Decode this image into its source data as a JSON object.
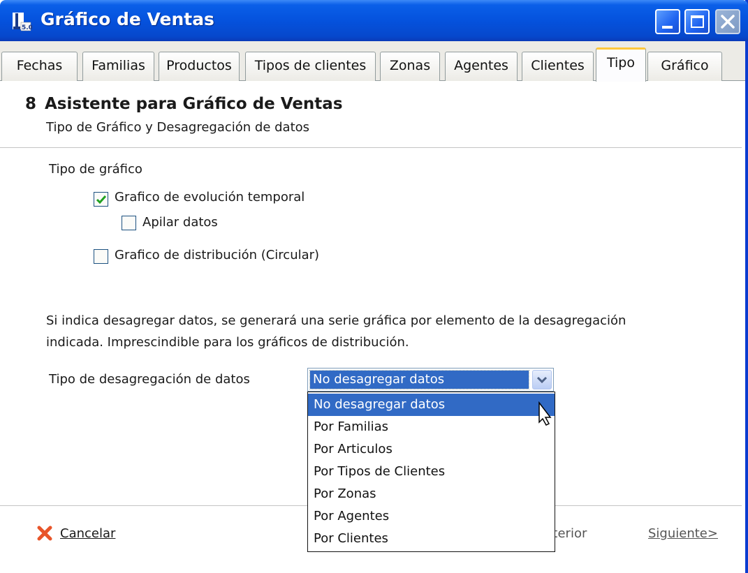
{
  "window": {
    "title": "Gráfico de Ventas"
  },
  "tabs": [
    {
      "label": "Fechas"
    },
    {
      "label": "Familias"
    },
    {
      "label": "Productos"
    },
    {
      "label": "Tipos de clientes"
    },
    {
      "label": "Zonas"
    },
    {
      "label": "Agentes"
    },
    {
      "label": "Clientes"
    },
    {
      "label": "Tipo",
      "active": true
    },
    {
      "label": "Gráfico"
    }
  ],
  "wizard": {
    "step": "8",
    "title": "Asistente para Gráfico de Ventas",
    "subtitle": "Tipo de Gráfico y Desagregación de datos"
  },
  "chart_type": {
    "label": "Tipo de gráfico",
    "options": [
      {
        "label": "Grafico de evolución temporal",
        "checked": true
      },
      {
        "label": "Apilar datos",
        "checked": false
      },
      {
        "label": "Grafico de distribución (Circular)",
        "checked": false
      }
    ]
  },
  "info_text": "Si indica desagregar datos, se generará una serie gráfica por elemento de la desagregación indicada. Imprescindible para los gráficos de distribución.",
  "breakdown": {
    "label": "Tipo de desagregación de datos",
    "value": "No desagregar datos",
    "options": [
      "No desagregar datos",
      "Por Familias",
      "Por Articulos",
      "Por Tipos de Clientes",
      "Por Zonas",
      "Por Agentes",
      "Por Clientes"
    ]
  },
  "footer": {
    "cancel_label": "Cancelar",
    "prev_label": "nterior",
    "next_label": "Siguiente>"
  },
  "colors": {
    "titlebar": "#0552dd",
    "selection": "#316ac5",
    "active_tab_accent": "#ffc83c",
    "check": "#21a121",
    "cancel_x": "#e8552a"
  },
  "icons": {
    "app": "app-icon",
    "minimize": "minimize-icon",
    "maximize": "maximize-icon",
    "close": "close-icon",
    "combo_arrow": "chevron-down-icon",
    "cancel": "cancel-x-icon",
    "checkmark": "checkmark-icon"
  }
}
